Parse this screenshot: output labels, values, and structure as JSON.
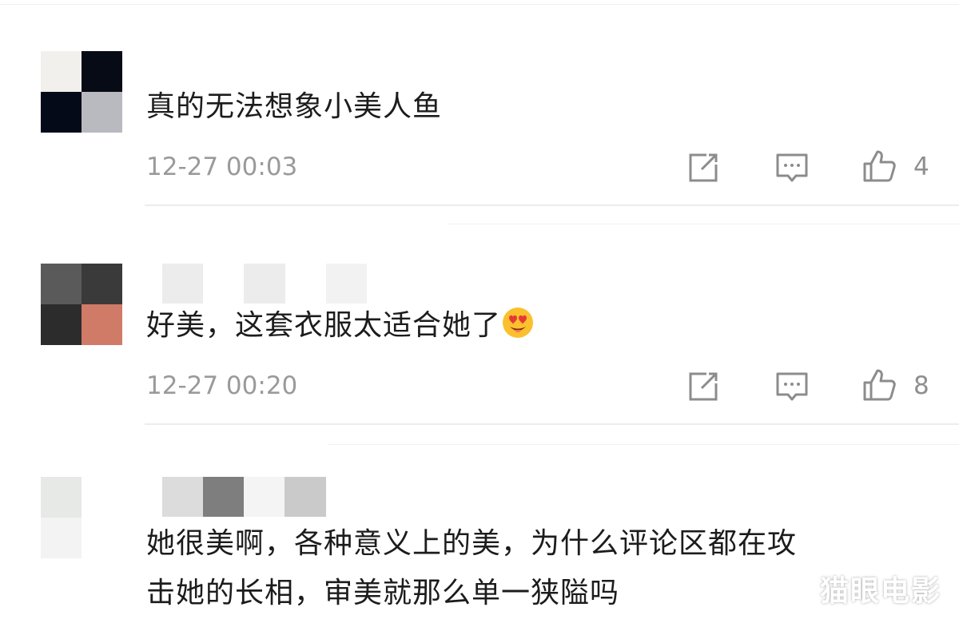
{
  "comments": [
    {
      "text": "真的无法想象小美人鱼",
      "time": "12-27 00:03",
      "likes": "4",
      "icons": [
        "share-icon",
        "reply-icon",
        "like-icon"
      ]
    },
    {
      "text": "好美，这套衣服太适合她了",
      "emoji": "heart-eyes-emoji",
      "time": "12-27 00:20",
      "likes": "8",
      "icons": [
        "share-icon",
        "reply-icon",
        "like-icon"
      ]
    },
    {
      "text_line1": "她很美啊，各种意义上的美，为什么评论区都在攻",
      "text_line2": "击她的长相，审美就那么单一狭隘吗"
    }
  ],
  "watermark": "猫眼电影",
  "colors": {
    "text": "#1c1c1c",
    "meta": "#9a9a9a",
    "icon": "#8c8c8c",
    "divider": "#ececec"
  }
}
